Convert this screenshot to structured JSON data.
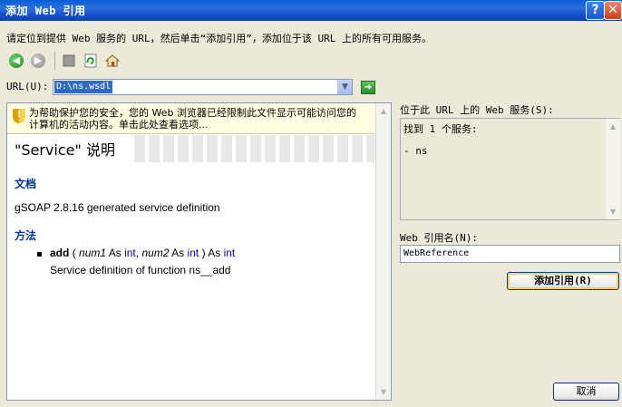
{
  "window": {
    "title": "添加 Web 引用",
    "help_label": "?",
    "close_label": "✕"
  },
  "instruction": "请定位到提供 Web 服务的 URL，然后单击“添加引用”，添加位于该 URL 上的所有可用服务。",
  "toolbar": {
    "back_icon": "back-arrow-icon",
    "forward_icon": "forward-arrow-icon",
    "stop_icon": "stop-icon",
    "refresh_icon": "refresh-icon",
    "home_icon": "home-icon"
  },
  "url": {
    "label": "URL(U):",
    "value": "D:\\ns.wsdl"
  },
  "browser": {
    "infobar_text": "为帮助保护您的安全，您的 Web 浏览器已经限制此文件显示可能访问您的计算机的活动内容。单击此处查看选项...",
    "infobar_close": "×",
    "service_title": "\"Service\" 说明",
    "doc_heading": "文档",
    "doc_text": "gSOAP 2.8.16 generated service definition",
    "methods_heading": "方法",
    "method": {
      "name": "add",
      "open": "(",
      "param1": "num1",
      "as1": "As",
      "type1": "int",
      "comma": ",",
      "param2": "num2",
      "as2": "As",
      "type2": "int",
      "close": ")",
      "as_ret": "As",
      "ret_type": "int",
      "description": "Service definition of function ns__add"
    }
  },
  "services": {
    "label": "位于此 URL 上的 Web 服务(S):",
    "found": "找到 1 个服务:",
    "items": [
      "- ns"
    ]
  },
  "web_ref": {
    "label": "Web 引用名(N):",
    "value": "WebReference"
  },
  "buttons": {
    "add_reference": "添加引用(R)",
    "cancel": "取消"
  },
  "colors": {
    "titlebar": "#0A5FD6",
    "heading": "#003399",
    "keyword": "#0000CC",
    "infobar": "#FFFFE1"
  }
}
